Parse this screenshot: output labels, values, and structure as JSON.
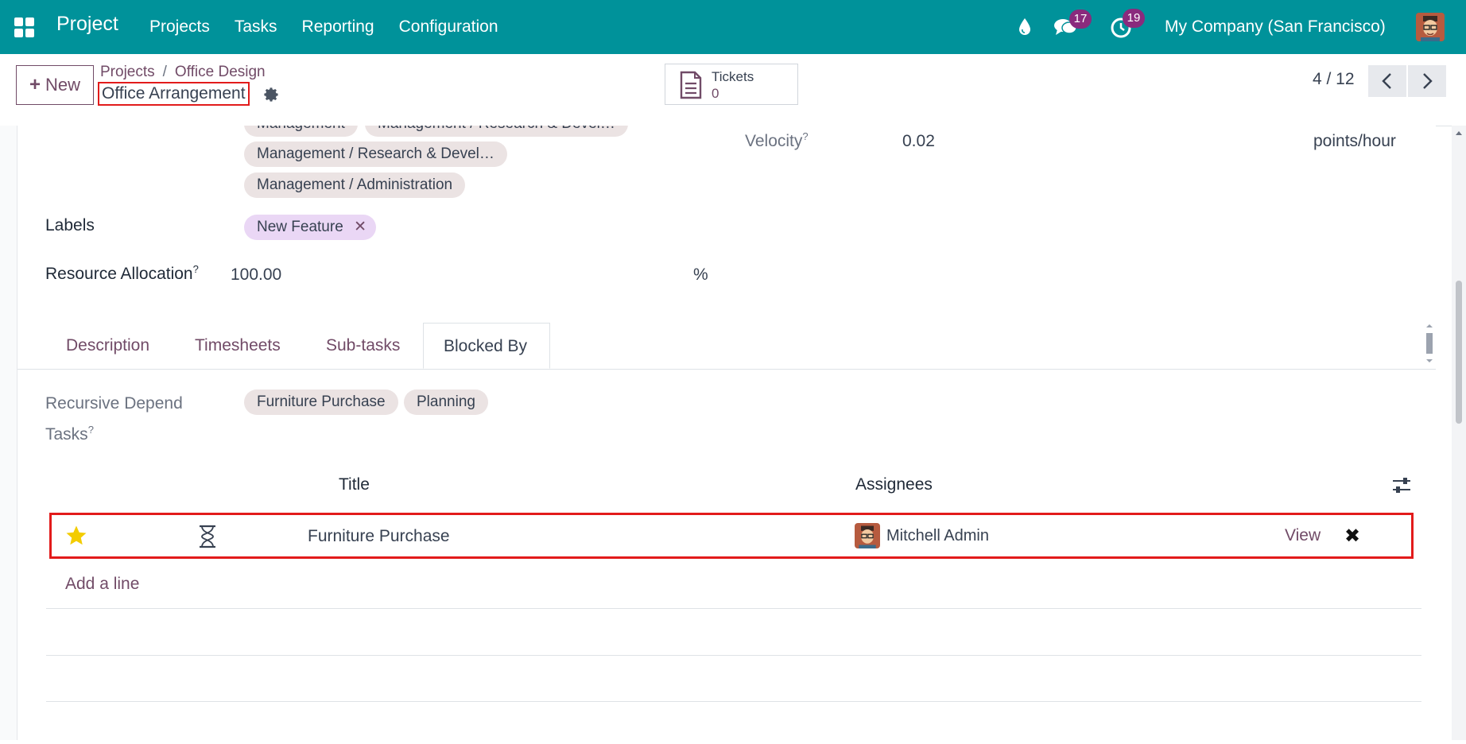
{
  "navbar": {
    "brand": "Project",
    "menu": [
      "Projects",
      "Tasks",
      "Reporting",
      "Configuration"
    ],
    "messages_badge": "17",
    "activities_badge": "19",
    "company": "My Company (San Francisco)"
  },
  "control_panel": {
    "new_label": "New",
    "breadcrumb": [
      "Projects",
      "Office Design"
    ],
    "breadcrumb_sep": "/",
    "record_title": "Office Arrangement",
    "tickets_label": "Tickets",
    "tickets_count": "0",
    "pager": "4 / 12"
  },
  "form": {
    "tags_partial": [
      "Management",
      "Management / Research & Devel…"
    ],
    "tag_research": "Management / Research & Devel…",
    "tag_admin": "Management / Administration",
    "velocity_label": "Velocity",
    "velocity_value": "0.02",
    "velocity_unit": "points/hour",
    "labels_label": "Labels",
    "label_tag": "New Feature",
    "resource_label": "Resource Allocation",
    "resource_value": "100.00",
    "resource_unit": "%",
    "help_mark": "?"
  },
  "tabs": [
    "Description",
    "Timesheets",
    "Sub-tasks",
    "Blocked By"
  ],
  "blocked_by": {
    "recursive_label_line1": "Recursive Depend",
    "recursive_label_line2": "Tasks",
    "recursive_tags": [
      "Furniture Purchase",
      "Planning"
    ],
    "columns": {
      "title": "Title",
      "assignees": "Assignees"
    },
    "rows": [
      {
        "title": "Furniture Purchase",
        "assignee": "Mitchell Admin",
        "view": "View"
      }
    ],
    "add_line": "Add a line"
  },
  "colors": {
    "navbar": "#00929a",
    "accent": "#714b67",
    "highlight": "#e21b1b",
    "star": "#f3cc00"
  }
}
